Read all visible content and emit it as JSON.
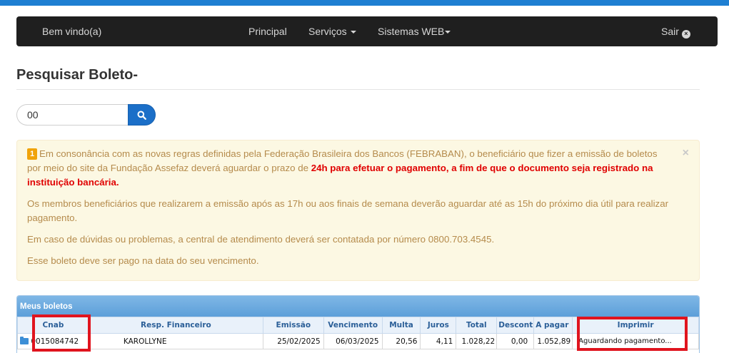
{
  "navbar": {
    "welcome": "Bem vindo(a)",
    "principal": "Principal",
    "servicos": "Serviços",
    "sistemas_web": "Sistemas WEB",
    "sair": "Sair"
  },
  "page": {
    "title": "Pesquisar Boleto-"
  },
  "search": {
    "value": "00"
  },
  "alert": {
    "badge": "1",
    "p1_normal": "Em consonância com as novas regras definidas pela Federação Brasileira dos Bancos (FEBRABAN), o beneficiário que fizer a emissão de boletos por meio do site da Fundação Assefaz deverá aguardar o prazo de ",
    "p1_bold": "24h para efetuar o pagamento, a fim de que o documento seja registrado na instituição bancária.",
    "p2": "Os membros beneficiários que realizarem a emissão após as 17h ou aos finais de semana deverão aguardar até as 15h do próximo dia útil para realizar pagamento.",
    "p3": "Em caso de dúvidas ou problemas, a central de atendimento deverá ser contatada por número 0800.703.4545.",
    "p4": "Esse boleto deve ser pago na data do seu vencimento.",
    "close": "×"
  },
  "table": {
    "title": "Meus boletos",
    "headers": [
      "Cnab",
      "Resp. Financeiro",
      "Emissão",
      "Vencimento",
      "Multa",
      "Juros",
      "Total",
      "Descont",
      "A pagar",
      "Imprimir"
    ],
    "rows": [
      {
        "cnab": "0015084742",
        "resp": "KAROLLYNE",
        "emissao": "25/02/2025",
        "vencimento": "06/03/2025",
        "multa": "20,56",
        "juros": "4,11",
        "total": "1.028,22",
        "desconto": "0,00",
        "a_pagar": "1.052,89",
        "imprimir": "Aguardando pagamento..."
      }
    ]
  },
  "colors": {
    "navbar_bg": "#1f1f1f",
    "accent": "#1b6fc8",
    "alert_bg": "#fcf8e3",
    "alert_text": "#b58b4c",
    "highlight_red": "#e0141e"
  }
}
